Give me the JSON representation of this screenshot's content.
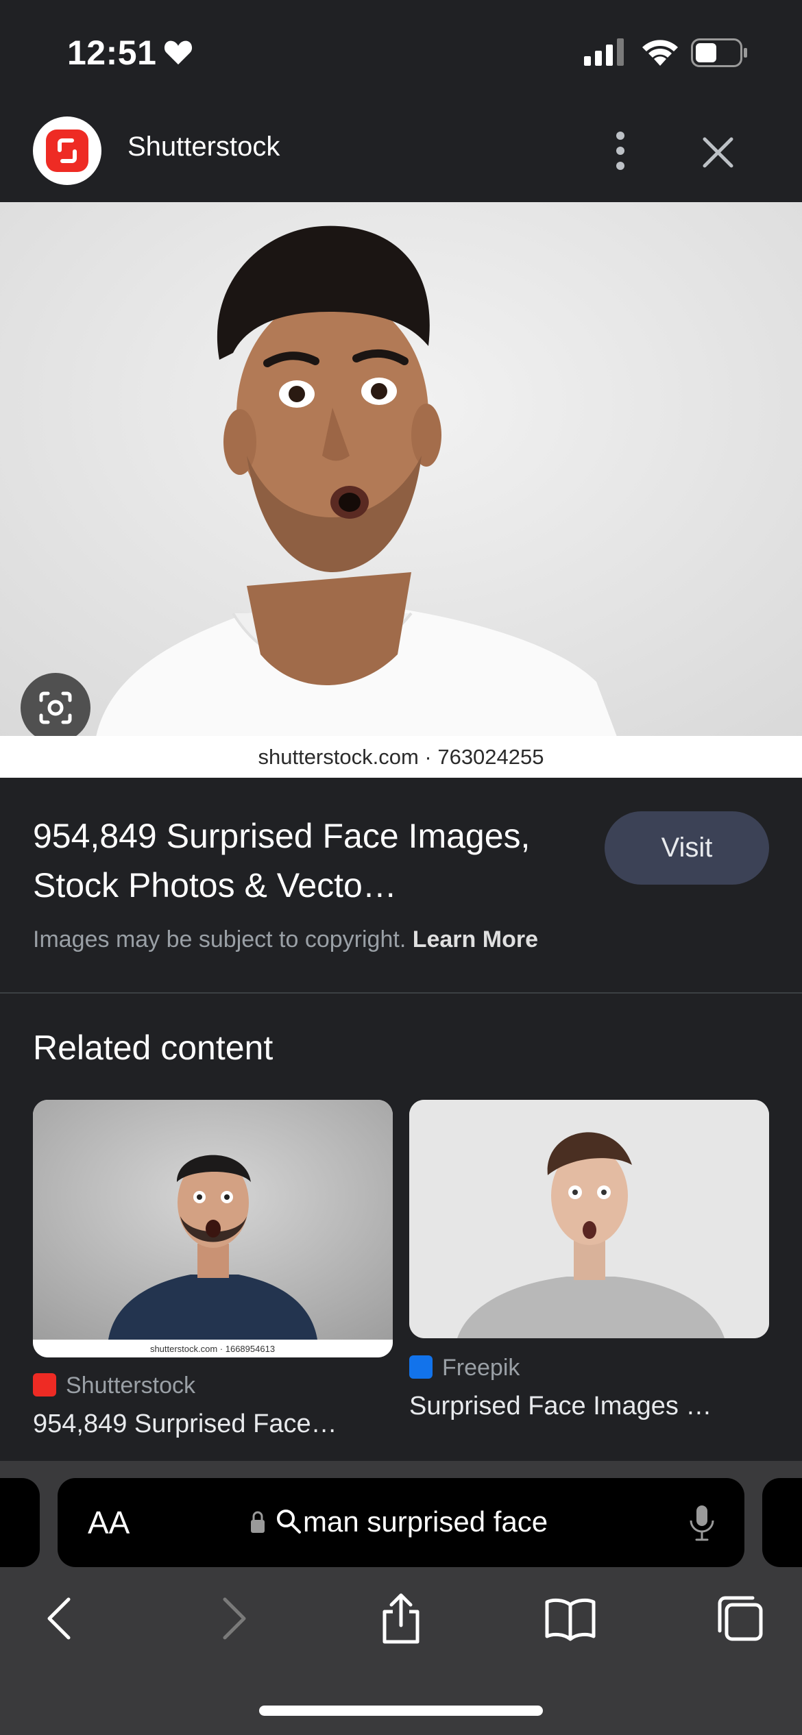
{
  "status_bar": {
    "time": "12:51"
  },
  "header": {
    "site_name": "Shutterstock"
  },
  "main_image": {
    "caption": "shutterstock.com · 763024255"
  },
  "result": {
    "title": "954,849 Surprised Face Images, Stock Photos & Vecto…",
    "visit_label": "Visit",
    "copyright_text": "Images may be subject to copyright.",
    "learn_more_label": "Learn More"
  },
  "related": {
    "heading": "Related content",
    "cards": [
      {
        "source": "Shutterstock",
        "title": "954,849 Surprised Face…",
        "caption": "shutterstock.com · 1668954613",
        "source_color": "#ee2b24"
      },
      {
        "source": "Freepik",
        "title": "Surprised Face Images …",
        "source_color": "#1273eb"
      }
    ]
  },
  "address_bar": {
    "text_size_label": "AA",
    "query": "man surprised face"
  },
  "icons": {
    "status": [
      "heart-icon",
      "signal-icon",
      "wifi-icon",
      "battery-icon"
    ],
    "header": [
      "site-logo",
      "more-vert-icon",
      "close-icon"
    ],
    "toolbar": [
      "back-icon",
      "forward-icon",
      "share-icon",
      "bookmarks-icon",
      "tabs-icon",
      "mic-icon",
      "lock-icon",
      "search-icon"
    ]
  }
}
